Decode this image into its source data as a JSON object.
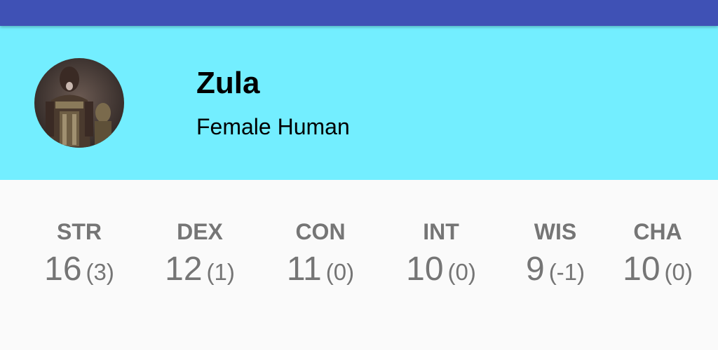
{
  "status_bar": {
    "color": "#3f51b5"
  },
  "header": {
    "background": "#73eeff",
    "avatar_icon": "character-portrait",
    "name": "Zula",
    "description": "Female Human"
  },
  "stats": [
    {
      "label": "STR",
      "score": "16",
      "modifier": "(3)"
    },
    {
      "label": "DEX",
      "score": "12",
      "modifier": "(1)"
    },
    {
      "label": "CON",
      "score": "11",
      "modifier": "(0)"
    },
    {
      "label": "INT",
      "score": "10",
      "modifier": "(0)"
    },
    {
      "label": "WIS",
      "score": "9",
      "modifier": "(-1)"
    },
    {
      "label": "CHA",
      "score": "10",
      "modifier": "(0)"
    }
  ]
}
